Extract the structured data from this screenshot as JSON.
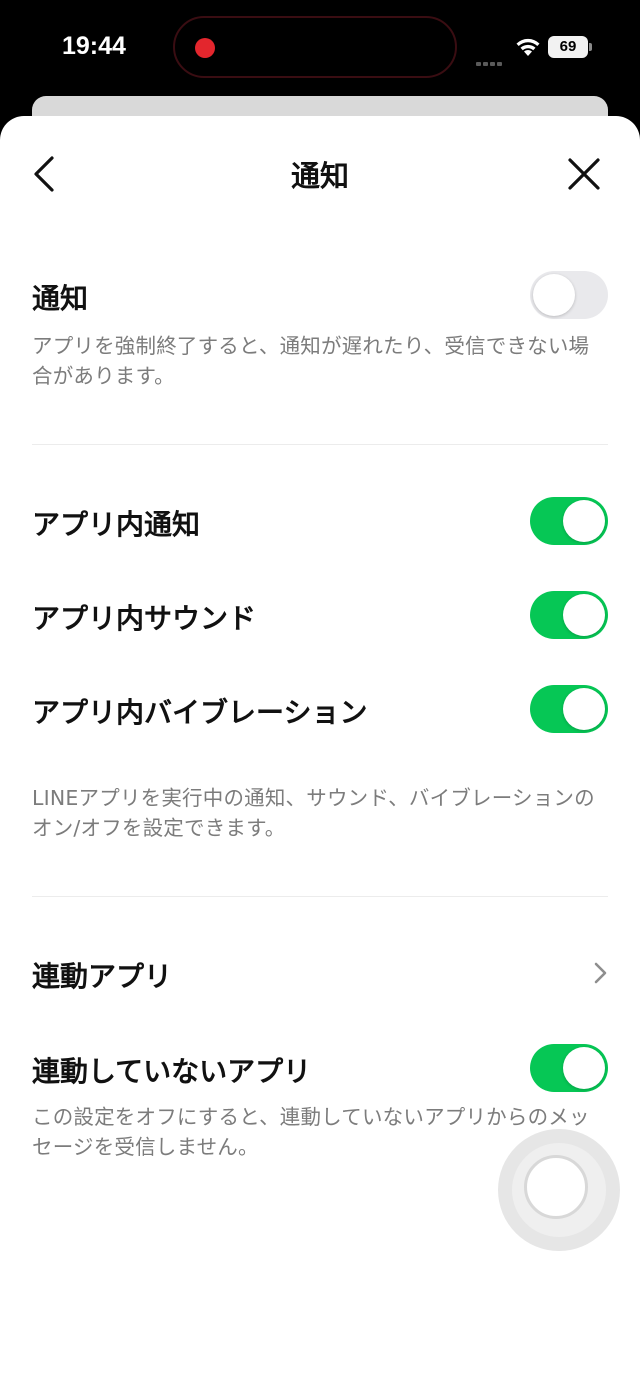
{
  "status_bar": {
    "time": "19:44",
    "battery": "69"
  },
  "header": {
    "title": "通知"
  },
  "notifications": {
    "label": "通知",
    "enabled": false,
    "description": "アプリを強制終了すると、通知が遅れたり、受信できない場合があります。"
  },
  "in_app": {
    "items": [
      {
        "label": "アプリ内通知",
        "enabled": true
      },
      {
        "label": "アプリ内サウンド",
        "enabled": true
      },
      {
        "label": "アプリ内バイブレーション",
        "enabled": true
      }
    ],
    "description": "LINEアプリを実行中の通知、サウンド、バイブレーションのオン/オフを設定できます。"
  },
  "linked": {
    "linked_apps_label": "連動アプリ",
    "unlinked_apps_label": "連動していないアプリ",
    "unlinked_enabled": true,
    "description": "この設定をオフにすると、連動していないアプリからのメッセージを受信しません。"
  },
  "colors": {
    "toggle_on": "#06c755",
    "toggle_off": "#e9e9ec",
    "recording": "#e3262d"
  }
}
